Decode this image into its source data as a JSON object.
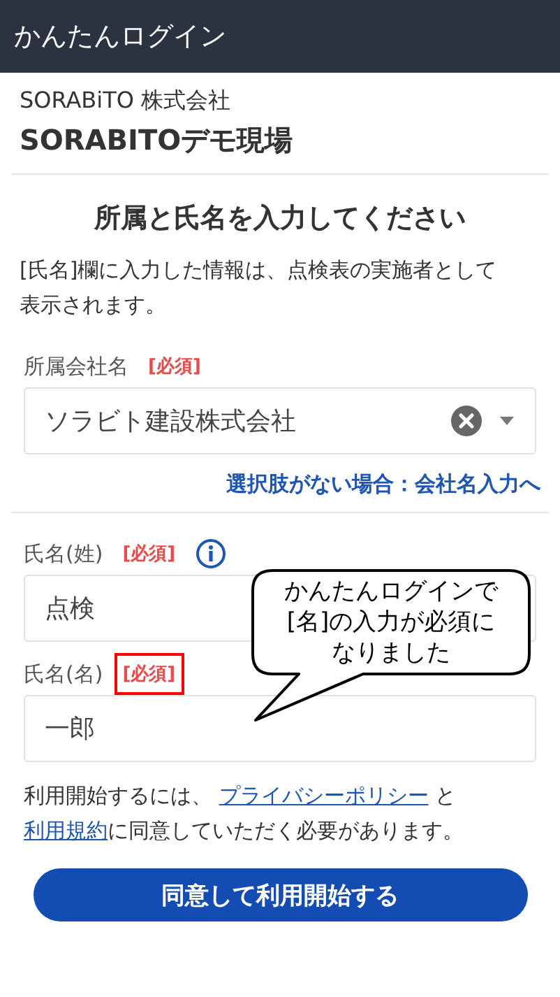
{
  "header": {
    "title": "かんたんログイン"
  },
  "site": {
    "company": "SORABiTO 株式会社",
    "name": "SORABITOデモ現場"
  },
  "heading": "所属と氏名を入力してください",
  "description": "[氏名]欄に入力した情報は、点検表の実施者として表示されます。",
  "fields": [
    {
      "kind": "select",
      "label": "所属会社名",
      "required_tag": "[必須]",
      "highlighted": false,
      "info": false,
      "value": "ソラビト建設株式会社",
      "link": "選択肢がない場合：会社名入力へ"
    },
    {
      "kind": "text",
      "label": "氏名(姓)",
      "required_tag": "[必須]",
      "highlighted": false,
      "info": true,
      "value": "点検"
    },
    {
      "kind": "text",
      "label": "氏名(名)",
      "required_tag": "[必須]",
      "highlighted": true,
      "info": false,
      "value": "一郎"
    }
  ],
  "terms": [
    {
      "kind": "text",
      "text": "利用開始するには、 "
    },
    {
      "kind": "link",
      "text": "プライバシーポリシー"
    },
    {
      "kind": "text",
      "text": " と "
    },
    {
      "kind": "link",
      "text": "利用規約"
    },
    {
      "kind": "text",
      "text": "に同意していただく必要があります。"
    }
  ],
  "submit_button": "同意して利用開始する",
  "callout": {
    "text": "かんたんログインで[名]の入力が必須になりました"
  }
}
